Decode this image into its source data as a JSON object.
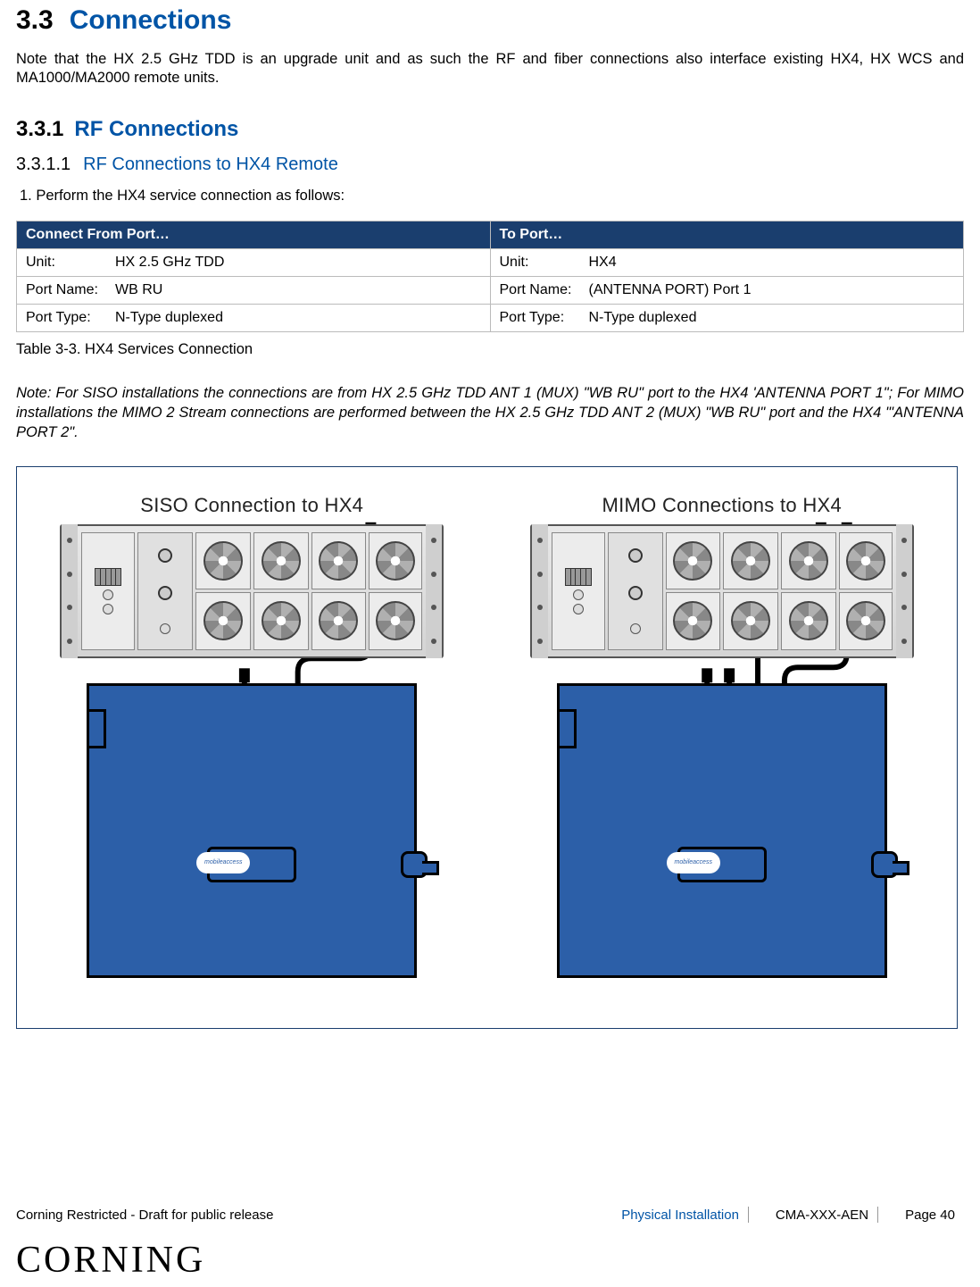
{
  "h1": {
    "num": "3.3",
    "title": "Connections"
  },
  "intro": "Note that the HX 2.5 GHz TDD is an upgrade unit and as such the RF and fiber connections also interface existing HX4, HX WCS and MA1000/MA2000 remote units.",
  "h2": {
    "num": "3.3.1",
    "title": "RF Connections"
  },
  "h3": {
    "num": "3.3.1.1",
    "title": "RF Connections to HX4 Remote"
  },
  "step1": "1.  Perform the HX4 service connection as follows:",
  "table": {
    "head_from": "Connect From Port…",
    "head_to": "To Port…",
    "rows": [
      {
        "from_label": "Unit:",
        "from_val": "HX 2.5 GHz TDD",
        "to_label": "Unit:",
        "to_val": "HX4"
      },
      {
        "from_label": "Port Name:",
        "from_val": "WB RU",
        "to_label": "Port Name:",
        "to_val": "(ANTENNA PORT) Port 1"
      },
      {
        "from_label": "Port Type:",
        "from_val": "N-Type duplexed",
        "to_label": "Port Type:",
        "to_val": "N-Type duplexed"
      }
    ]
  },
  "caption": "Table 3-3. HX4 Services Connection",
  "note": "Note: For SISO installations the connections are from HX 2.5 GHz TDD ANT 1 (MUX) \"WB RU\" port to the HX4 'ANTENNA PORT 1\"; For MIMO installations the MIMO 2 Stream connections are performed between the HX 2.5 GHz TDD ANT 2 (MUX) \"WB RU\" port and the HX4 \"'ANTENNA PORT 2\".",
  "diagram": {
    "siso_title": "SISO Connection to HX4",
    "mimo_title": "MIMO Connections to HX4",
    "badge": "mobileaccess"
  },
  "footer": {
    "left": "Corning Restricted - Draft for public release",
    "section": "Physical Installation",
    "doc": "CMA-XXX-AEN",
    "page": "Page 40",
    "logo": "CORNING"
  }
}
